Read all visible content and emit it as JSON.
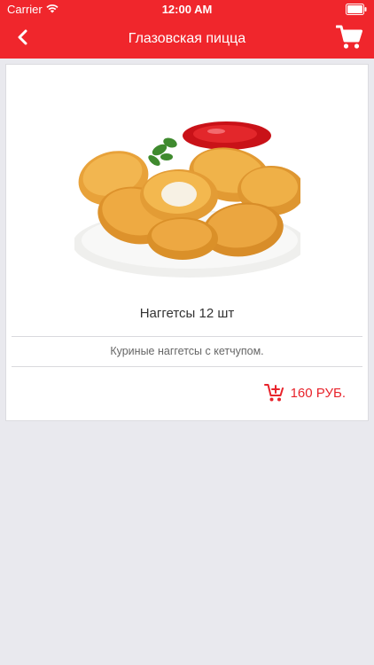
{
  "status_bar": {
    "carrier": "Carrier",
    "time": "12:00 AM"
  },
  "nav": {
    "title": "Глазовская пицца",
    "back_icon": "chevron-left-icon",
    "cart_icon": "shopping-cart-icon"
  },
  "product": {
    "name": "Наггетсы 12 шт",
    "description": "Куриные наггетсы с кетчупом.",
    "price": "160 РУБ.",
    "add_to_cart_icon": "cart-add-icon"
  },
  "colors": {
    "brand_red": "#f0262c",
    "price_red": "#e8232b",
    "background": "#e9e9ee"
  }
}
